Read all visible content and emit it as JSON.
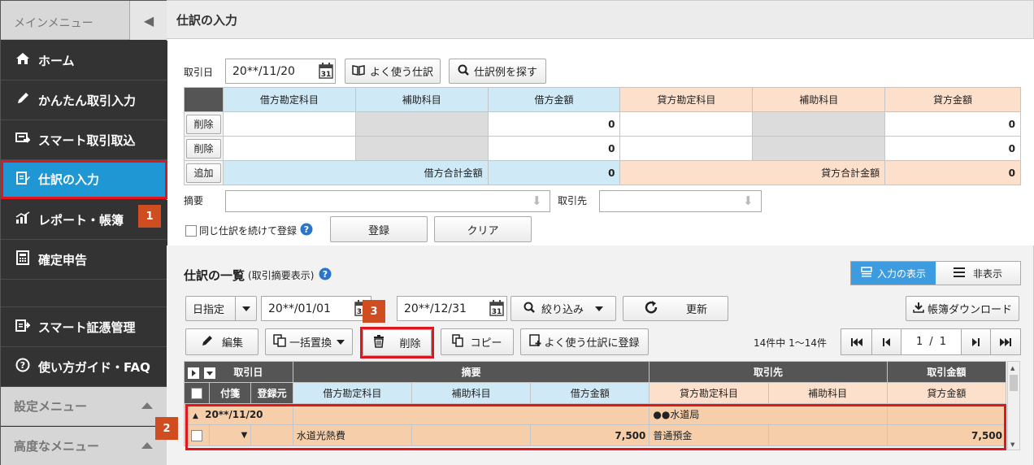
{
  "sidebar": {
    "header": "メインメニュー",
    "collapse_icon": "◀",
    "items": [
      {
        "label": "ホーム",
        "icon": "home-icon"
      },
      {
        "label": "かんたん取引入力",
        "icon": "pencil-icon"
      },
      {
        "label": "スマート取引取込",
        "icon": "import-icon"
      },
      {
        "label": "仕訳の入力",
        "icon": "journal-icon"
      },
      {
        "label": "レポート・帳簿",
        "icon": "report-icon"
      },
      {
        "label": "確定申告",
        "icon": "calc-icon"
      },
      {
        "label": "スマート証憑管理",
        "icon": "voucher-icon"
      },
      {
        "label": "使い方ガイド・FAQ",
        "icon": "help-icon"
      }
    ],
    "settings_menu": "設定メニュー",
    "advanced_menu": "高度なメニュー"
  },
  "badges": {
    "b1": "1",
    "b2": "2",
    "b3": "3"
  },
  "page_title": "仕訳の入力",
  "entry": {
    "date_label": "取引日",
    "date_value": "20**/11/20",
    "favorite_btn": "よく使う仕訳",
    "search_example_btn": "仕訳例を探す",
    "cols": [
      "借方勘定科目",
      "補助科目",
      "借方金額",
      "貸方勘定科目",
      "補助科目",
      "貸方金額"
    ],
    "delete_btn": "削除",
    "add_btn": "追加",
    "zero": "0",
    "debit_total_label": "借方合計金額",
    "credit_total_label": "貸方合計金額",
    "memo_label": "摘要",
    "partner_label": "取引先",
    "continue_label": "同じ仕訳を続けて登録",
    "register_btn": "登録",
    "clear_btn": "クリア"
  },
  "list": {
    "title": "仕訳の一覧",
    "subtitle": "(取引摘要表示)",
    "show_input_btn": "入力の表示",
    "hide_btn": "非表示",
    "period_type": "日指定",
    "from_date": "20**/01/01",
    "to_date": "20**/12/31",
    "filter_btn": "絞り込み",
    "refresh_btn": "更新",
    "download_btn": "帳簿ダウンロード",
    "edit_btn": "編集",
    "bulk_replace_btn": "一括置換",
    "delete_btn": "削除",
    "copy_btn": "コピー",
    "favorite_register_btn": "よく使う仕訳に登録",
    "count_text": "14件中 1〜14件",
    "page_current": "1",
    "page_sep": "/",
    "page_total": "1",
    "headers_row1": [
      "取引日",
      "摘要",
      "取引先",
      "取引金額"
    ],
    "headers_row2": [
      "付箋",
      "登録元",
      "借方勘定科目",
      "補助科目",
      "借方金額",
      "貸方勘定科目",
      "補助科目",
      "貸方金額"
    ],
    "row": {
      "date": "20**/11/20",
      "partner": "●●水道局",
      "memo": "水道光熱費",
      "debit_amount": "7,500",
      "credit_account": "普通預金",
      "credit_amount": "7,500"
    }
  }
}
